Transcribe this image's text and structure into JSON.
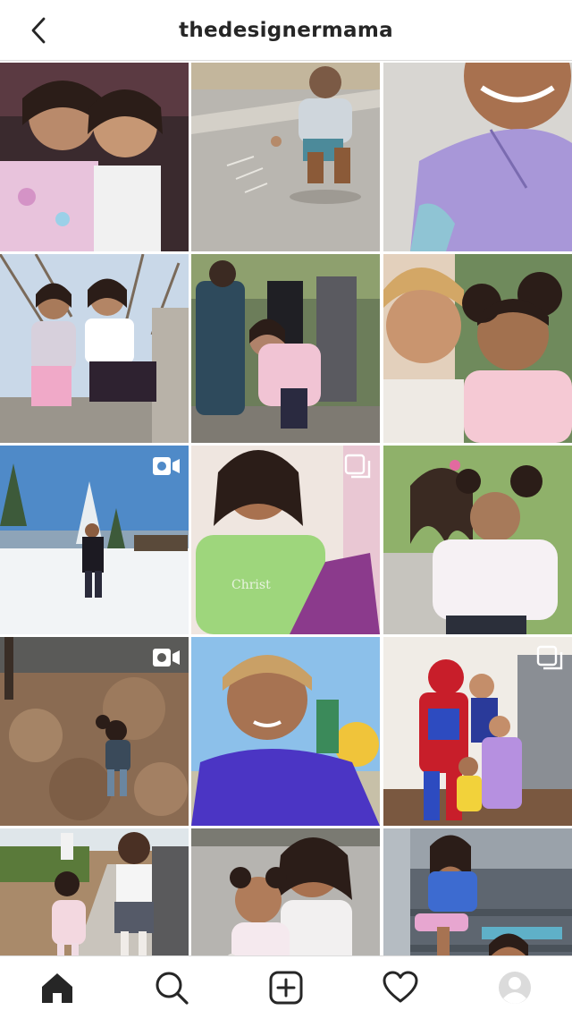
{
  "header": {
    "title": "thedesignermama",
    "back_icon": "chevron-left-icon"
  },
  "colors": {
    "text": "#262626",
    "divider": "#dbdbdb",
    "background": "#ffffff"
  },
  "grid": {
    "columns": 3,
    "posts": [
      {
        "kind": "photo",
        "scene": "two girls smiling close-up"
      },
      {
        "kind": "photo",
        "scene": "girl drawing with chalk on sidewalk"
      },
      {
        "kind": "photo",
        "scene": "girl in lavender hoodie close-up"
      },
      {
        "kind": "photo",
        "scene": "two girls sitting on rocks in sun"
      },
      {
        "kind": "photo",
        "scene": "family walking, girl in pink jacket"
      },
      {
        "kind": "photo",
        "scene": "mother and daughter hugging"
      },
      {
        "kind": "video",
        "badge_icon": "video-camera-icon",
        "scene": "girl in the snow"
      },
      {
        "kind": "carousel",
        "badge_icon": "multiple-photos-icon",
        "scene": "girl in green shirt with gift bag"
      },
      {
        "kind": "photo",
        "scene": "two sisters hugging outdoors"
      },
      {
        "kind": "video",
        "badge_icon": "video-camera-icon",
        "scene": "kids playing in leaves"
      },
      {
        "kind": "photo",
        "scene": "girl in blue sweater smiling"
      },
      {
        "kind": "carousel",
        "badge_icon": "multiple-photos-icon",
        "scene": "girls with spider-man costume"
      },
      {
        "kind": "photo",
        "scene": "two girls walking down path"
      },
      {
        "kind": "photo",
        "scene": "sisters posing, thumbs up"
      },
      {
        "kind": "photo",
        "scene": "girls sitting on porch steps"
      }
    ]
  },
  "tabbar": {
    "tabs": [
      {
        "icon": "home-icon",
        "active": true
      },
      {
        "icon": "search-icon",
        "active": false
      },
      {
        "icon": "new-post-icon",
        "active": false
      },
      {
        "icon": "heart-icon",
        "active": false
      },
      {
        "icon": "profile-avatar-icon",
        "active": false
      }
    ]
  }
}
